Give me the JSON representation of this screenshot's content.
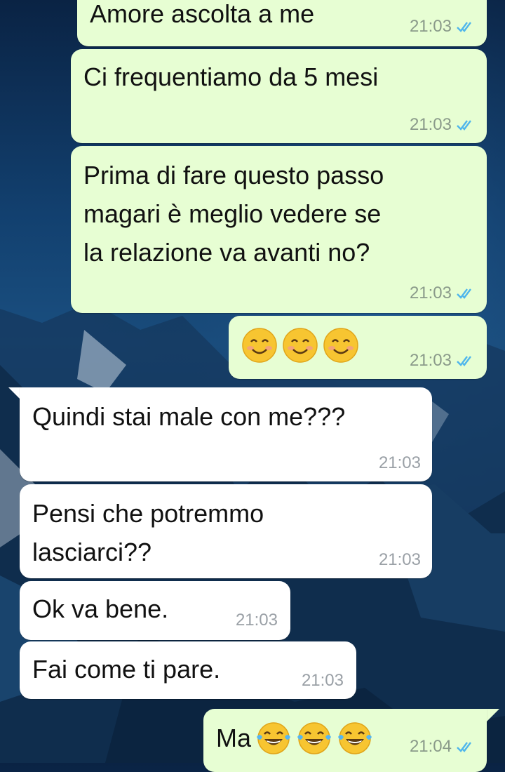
{
  "colors": {
    "outgoing_bubble": "#e7fed3",
    "incoming_bubble": "#ffffff",
    "read_ticks": "#4fb6ec"
  },
  "messages": [
    {
      "direction": "out",
      "text": "Amore ascolta a me",
      "time": "21:03",
      "status_icon": "double-check-read-icon"
    },
    {
      "direction": "out",
      "text": "Ci frequentiamo da 5 mesi",
      "time": "21:03",
      "status_icon": "double-check-read-icon"
    },
    {
      "direction": "out",
      "text": "Prima di fare questo passo\nmagari è meglio vedere se\nla relazione va avanti no?",
      "time": "21:03",
      "status_icon": "double-check-read-icon"
    },
    {
      "direction": "out",
      "text": "",
      "emojis": [
        "smiling-face-icon",
        "smiling-face-icon",
        "smiling-face-icon"
      ],
      "time": "21:03",
      "status_icon": "double-check-read-icon"
    },
    {
      "direction": "in",
      "text": "Quindi stai male con me???",
      "time": "21:03"
    },
    {
      "direction": "in",
      "text": "Pensi che potremmo\nlasciarci??",
      "time": "21:03"
    },
    {
      "direction": "in",
      "text": "Ok va bene.",
      "time": "21:03"
    },
    {
      "direction": "in",
      "text": "Fai come ti pare.",
      "time": "21:03"
    },
    {
      "direction": "out",
      "text": "Ma",
      "emojis": [
        "tears-of-joy-icon",
        "tears-of-joy-icon",
        "tears-of-joy-icon"
      ],
      "time": "21:04",
      "status_icon": "double-check-read-icon"
    }
  ]
}
